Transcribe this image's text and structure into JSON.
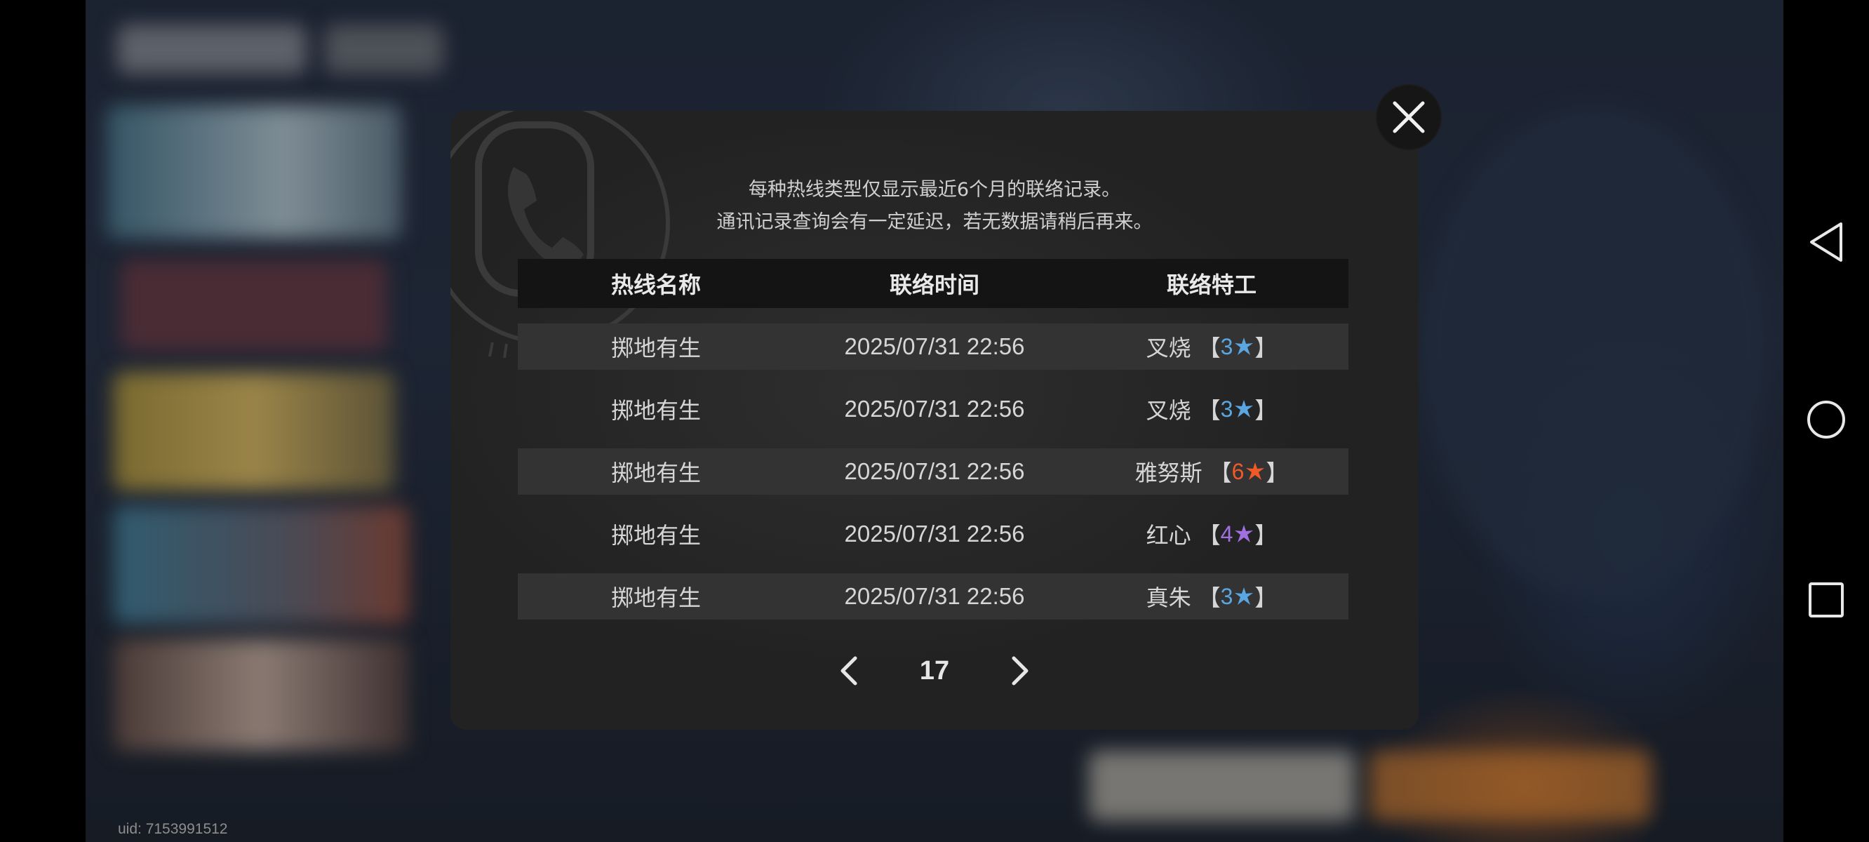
{
  "notice": {
    "line1": "每种热线类型仅显示最近6个月的联络记录。",
    "line2": "通讯记录查询会有一定延迟，若无数据请稍后再来。"
  },
  "table": {
    "headers": [
      "热线名称",
      "联络时间",
      "联络特工"
    ],
    "rows": [
      {
        "hotline": "掷地有生",
        "time": "2025/07/31 22:56",
        "agent": "叉烧",
        "rank": "3",
        "rank_color": "#5aa6e0"
      },
      {
        "hotline": "掷地有生",
        "time": "2025/07/31 22:56",
        "agent": "叉烧",
        "rank": "3",
        "rank_color": "#5aa6e0"
      },
      {
        "hotline": "掷地有生",
        "time": "2025/07/31 22:56",
        "agent": "雅努斯",
        "rank": "6",
        "rank_color": "#f05a28"
      },
      {
        "hotline": "掷地有生",
        "time": "2025/07/31 22:56",
        "agent": "红心",
        "rank": "4",
        "rank_color": "#a070e0"
      },
      {
        "hotline": "掷地有生",
        "time": "2025/07/31 22:56",
        "agent": "真朱",
        "rank": "3",
        "rank_color": "#5aa6e0"
      }
    ],
    "bracket_open": "【",
    "bracket_close": "】"
  },
  "pagination": {
    "page": "17",
    "prev_icon": "chevron-left-icon",
    "next_icon": "chevron-right-icon"
  },
  "footer": {
    "uid": "uid: 7153991512"
  },
  "icons": {
    "close": "close-icon",
    "phone": "phone-icon",
    "star": "star-icon",
    "nav_back": "triangle-back-icon",
    "nav_home": "circle-home-icon",
    "nav_recent": "square-recent-icon"
  }
}
